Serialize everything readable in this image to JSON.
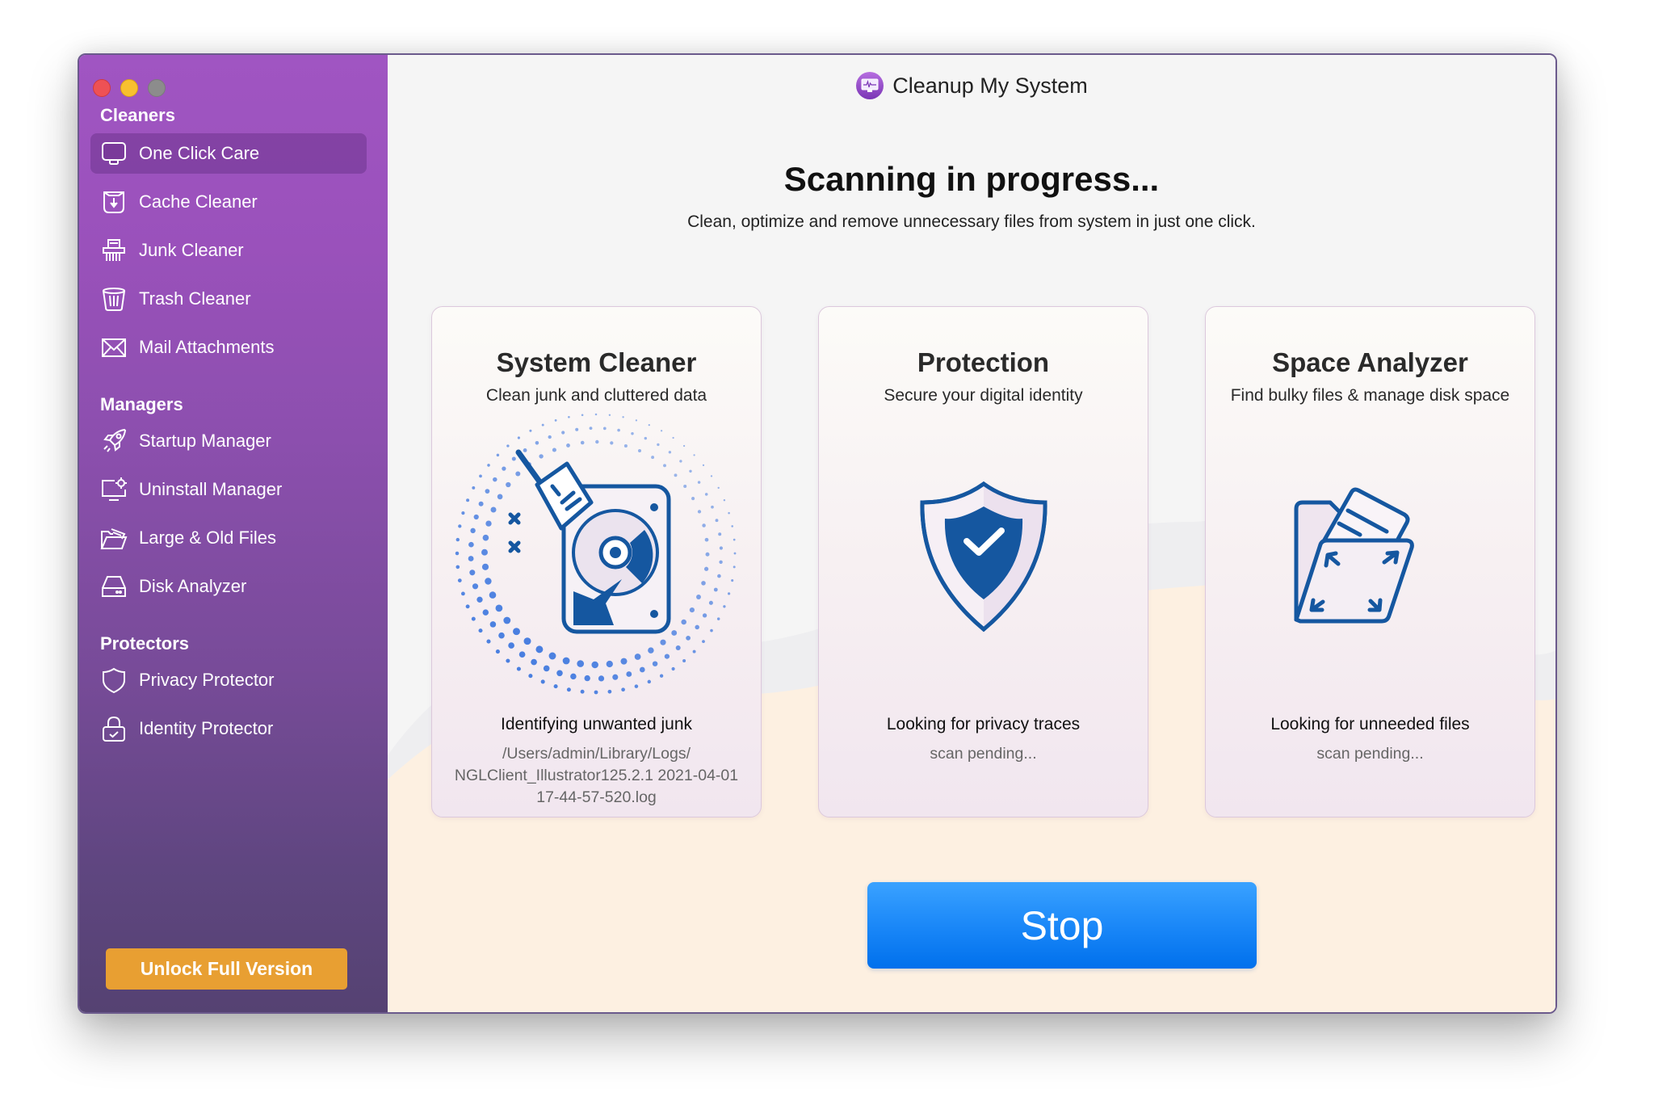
{
  "window": {
    "title": "Cleanup My System",
    "traffic_lights": [
      "close",
      "minimize",
      "zoom"
    ]
  },
  "sidebar": {
    "sections": [
      {
        "label": "Cleaners",
        "items": [
          {
            "label": "One Click Care",
            "icon": "monitor-icon",
            "active": true
          },
          {
            "label": "Cache Cleaner",
            "icon": "cache-download-icon"
          },
          {
            "label": "Junk Cleaner",
            "icon": "shredder-icon"
          },
          {
            "label": "Trash Cleaner",
            "icon": "trash-icon"
          },
          {
            "label": "Mail Attachments",
            "icon": "mail-icon"
          }
        ]
      },
      {
        "label": "Managers",
        "items": [
          {
            "label": "Startup Manager",
            "icon": "rocket-icon"
          },
          {
            "label": "Uninstall Manager",
            "icon": "monitor-gear-icon"
          },
          {
            "label": "Large & Old Files",
            "icon": "open-folder-icon"
          },
          {
            "label": "Disk Analyzer",
            "icon": "hard-drive-icon"
          }
        ]
      },
      {
        "label": "Protectors",
        "items": [
          {
            "label": "Privacy Protector",
            "icon": "shield-icon"
          },
          {
            "label": "Identity Protector",
            "icon": "lock-icon"
          }
        ]
      }
    ],
    "unlock_button": "Unlock Full Version"
  },
  "main": {
    "heading": "Scanning in progress...",
    "subheading": "Clean, optimize and remove unnecessary files from system in just one click.",
    "cards": [
      {
        "title": "System Cleaner",
        "subtitle": "Clean junk and cluttered data",
        "icon": "disk-broom-icon",
        "status": "Identifying unwanted junk",
        "detail_lines": [
          "/Users/admin/Library/Logs/",
          "NGLClient_Illustrator125.2.1 2021-04-01",
          "17-44-57-520.log"
        ]
      },
      {
        "title": "Protection",
        "subtitle": "Secure your digital identity",
        "icon": "shield-check-icon",
        "status": "Looking for privacy traces",
        "detail_lines": [
          "scan pending..."
        ]
      },
      {
        "title": "Space Analyzer",
        "subtitle": "Find bulky files & manage disk space",
        "icon": "folder-expand-icon",
        "status": "Looking for unneeded files",
        "detail_lines": [
          "scan pending..."
        ]
      }
    ],
    "stop_button": "Stop"
  },
  "colors": {
    "sidebar_top": "#a055c2",
    "sidebar_bottom": "#554272",
    "accent_orange": "#e89f32",
    "stop_blue": "#1b88f8",
    "icon_blue": "#1557a0",
    "dot_blue": "#4a7fe0"
  }
}
